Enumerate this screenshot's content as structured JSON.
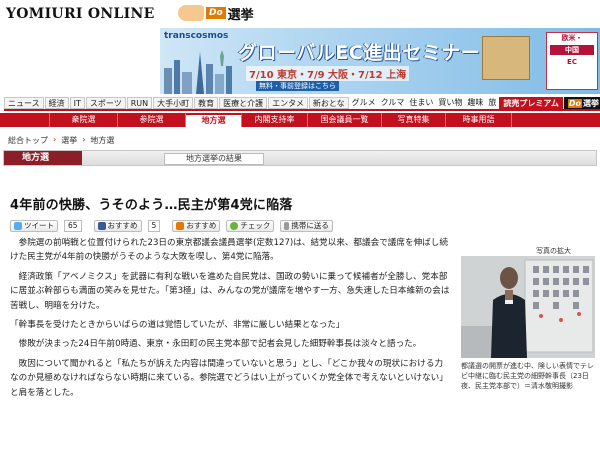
{
  "header": {
    "logo": "YOMIURI ONLINE",
    "do_badge": "Do",
    "do_label": "選挙"
  },
  "banner": {
    "brand": "transcosmos",
    "title": "グローバルEC進出セミナー",
    "dates": "7/10 東京・7/9 大阪・7/12 上海",
    "note": "無料・事前登録はこちら",
    "side_1": "欧米・",
    "side_2": "中国",
    "side_3": "EC"
  },
  "category_nav": [
    {
      "label": "ニュース",
      "style": "box"
    },
    {
      "label": "経済",
      "style": "box"
    },
    {
      "label": "IT",
      "style": "box"
    },
    {
      "label": "スポーツ",
      "style": "box"
    },
    {
      "label": "RUN",
      "style": "box"
    },
    {
      "label": "大手小町",
      "style": "box"
    },
    {
      "label": "教育",
      "style": "box"
    },
    {
      "label": "医療と介護",
      "style": "box"
    },
    {
      "label": "エンタメ",
      "style": "box"
    },
    {
      "label": "新おとな",
      "style": "box"
    },
    {
      "label": "グルメ",
      "style": "plain"
    },
    {
      "label": "クルマ",
      "style": "plain"
    },
    {
      "label": "住まい",
      "style": "plain"
    },
    {
      "label": "買い物",
      "style": "plain"
    },
    {
      "label": "趣味",
      "style": "plain"
    },
    {
      "label": "旅",
      "style": "plain"
    },
    {
      "label": "読売プレミアム",
      "style": "prem"
    },
    {
      "label": "選挙",
      "style": "do",
      "badge": "Do"
    }
  ],
  "election_nav": [
    {
      "label": "",
      "active": false,
      "w": 50
    },
    {
      "label": "衆院選",
      "active": false,
      "w": 68
    },
    {
      "label": "参院選",
      "active": false,
      "w": 68
    },
    {
      "label": "地方選",
      "active": true,
      "w": 56
    },
    {
      "label": "内閣支持率",
      "active": false,
      "w": 66
    },
    {
      "label": "国会議員一覧",
      "active": false,
      "w": 74
    },
    {
      "label": "写真特集",
      "active": false,
      "w": 64
    },
    {
      "label": "時事用語",
      "active": false,
      "w": 66
    }
  ],
  "breadcrumb": [
    "総合トップ",
    "選挙",
    "地方選"
  ],
  "section": {
    "label": "地方選",
    "link": "地方選挙の結果"
  },
  "article": {
    "headline": "4年前の快勝、うそのよう…民主が第4党に陥落",
    "social": {
      "tweet": "ツイート",
      "tweet_count": "65",
      "recommend": "おすすめ",
      "recommend_count": "5",
      "recommend2": "おすすめ",
      "check": "チェック",
      "mobile": "携帯に送る"
    },
    "paragraphs": [
      {
        "text": "参院選の前哨戦と位置付けられた23日の東京都議会議員選挙(定数127)は、結党以来、都議会で議席を伸ばし続けた民主党が4年前の快勝がうそのような大敗を喫し、第4党に陥落。",
        "quote": false
      },
      {
        "text": "経済政策「アベノミクス」を武器に有利な戦いを進めた自民党は、国政の勢いに乗って候補者が全勝し、党本部に居並ぶ幹部らも満面の笑みを見せた。「第3極」は、みんなの党が議席を増やす一方、急失速した日本維新の会は苦戦し、明暗を分けた。",
        "quote": false
      },
      {
        "text": "「幹事長を受けたときからいばらの道は覚悟していたが、非常に厳しい結果となった」",
        "quote": true
      },
      {
        "text": "惨敗が決まった24日午前0時過、東京・永田町の民主党本部で記者会見した細野幹事長は淡々と語った。",
        "quote": false
      },
      {
        "text": "敗因について聞かれると「私たちが訴えた内容は間違っていないと思う」とし、「どこか我々の現状における力なのか見極めなければならない時期に来ている。参院選でどうはい上がっていくか党全体で考えないといけない」と肩を落とした。",
        "quote": false
      }
    ]
  },
  "photo": {
    "zoom_label": "写真の拡大",
    "caption": "都議選の開票が進む中、険しい表情でテレビ中継に臨む民主党の細野幹事長（23日夜、民主党本部で）＝清水敬明撮影"
  },
  "colors": {
    "accent_red": "#c2101e",
    "section_maroon": "#8b1e27",
    "do_orange": "#e07a00"
  }
}
